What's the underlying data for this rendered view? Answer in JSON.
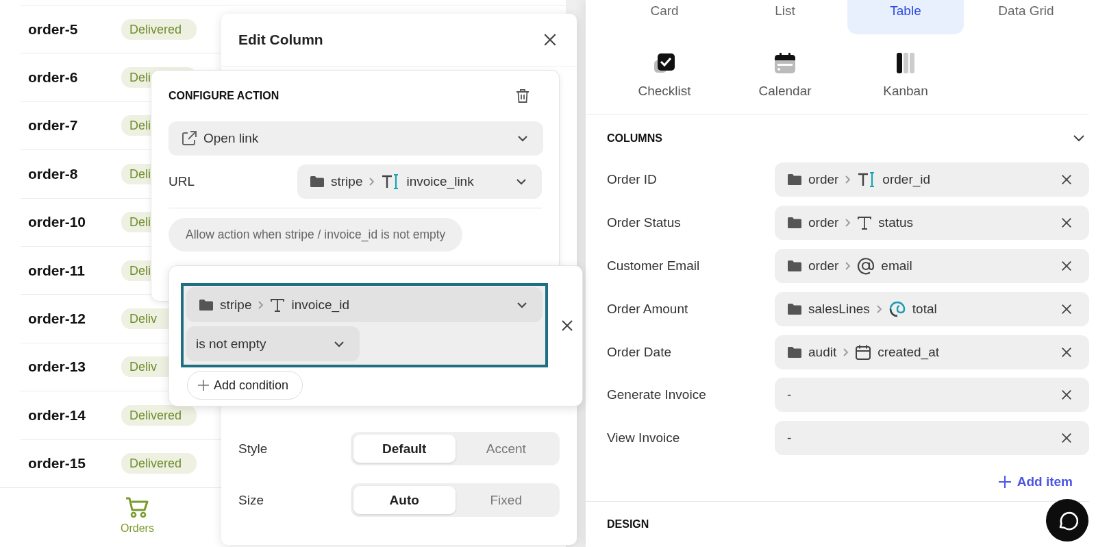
{
  "orders": [
    {
      "id": "order-5",
      "status": "Delivered"
    },
    {
      "id": "order-6",
      "status": "Deli"
    },
    {
      "id": "order-7",
      "status": "Deli"
    },
    {
      "id": "order-8",
      "status": "Deli"
    },
    {
      "id": "order-10",
      "status": "Deli"
    },
    {
      "id": "order-11",
      "status": "Deli"
    },
    {
      "id": "order-12",
      "status": "Deliv"
    },
    {
      "id": "order-13",
      "status": "Deliv"
    },
    {
      "id": "order-14",
      "status": "Delivered"
    },
    {
      "id": "order-15",
      "status": "Delivered"
    }
  ],
  "bottom_nav": [
    {
      "label": "Orders",
      "selected": true
    }
  ],
  "edit_column": {
    "title": "Edit Column",
    "settings": [
      {
        "label": "Style",
        "options": [
          {
            "label": "Default",
            "selected": true
          },
          {
            "label": "Accent",
            "selected": false
          }
        ]
      },
      {
        "label": "Size",
        "options": [
          {
            "label": "Auto",
            "selected": true
          },
          {
            "label": "Fixed",
            "selected": false
          }
        ]
      }
    ]
  },
  "configure_action": {
    "title": "CONFIGURE ACTION",
    "action": "Open link",
    "url_label": "URL",
    "url": {
      "source": "stripe",
      "field": "invoice_link",
      "kind": "id"
    },
    "condition_summary": "Allow action when stripe / invoice_id is not empty"
  },
  "condition_editor": {
    "field": {
      "source": "stripe",
      "field": "invoice_id",
      "kind": "text"
    },
    "operator": "is not empty",
    "add_label": "Add condition"
  },
  "view_types": [
    {
      "label": "Card",
      "selected": false
    },
    {
      "label": "List",
      "selected": false
    },
    {
      "label": "Table",
      "selected": true
    },
    {
      "label": "Data Grid",
      "selected": false
    }
  ],
  "layouts": [
    {
      "label": "Checklist",
      "kind": "checklist"
    },
    {
      "label": "Calendar",
      "kind": "calendar"
    },
    {
      "label": "Kanban",
      "kind": "kanban"
    }
  ],
  "columns": {
    "title": "COLUMNS",
    "expanded": true,
    "items": [
      {
        "label": "Order ID",
        "source": "order",
        "field": "order_id",
        "kind": "id"
      },
      {
        "label": "Order Status",
        "source": "order",
        "field": "status",
        "kind": "text"
      },
      {
        "label": "Customer Email",
        "source": "order",
        "field": "email",
        "kind": "email"
      },
      {
        "label": "Order Amount",
        "source": "salesLines",
        "field": "total",
        "kind": "formula"
      },
      {
        "label": "Order Date",
        "source": "audit",
        "field": "created_at",
        "kind": "date"
      },
      {
        "label": "Generate Invoice",
        "value": "-",
        "kind": "empty"
      },
      {
        "label": "View Invoice",
        "value": "-",
        "kind": "empty"
      }
    ],
    "add_label": "Add item"
  },
  "design": {
    "title": "DESIGN"
  }
}
